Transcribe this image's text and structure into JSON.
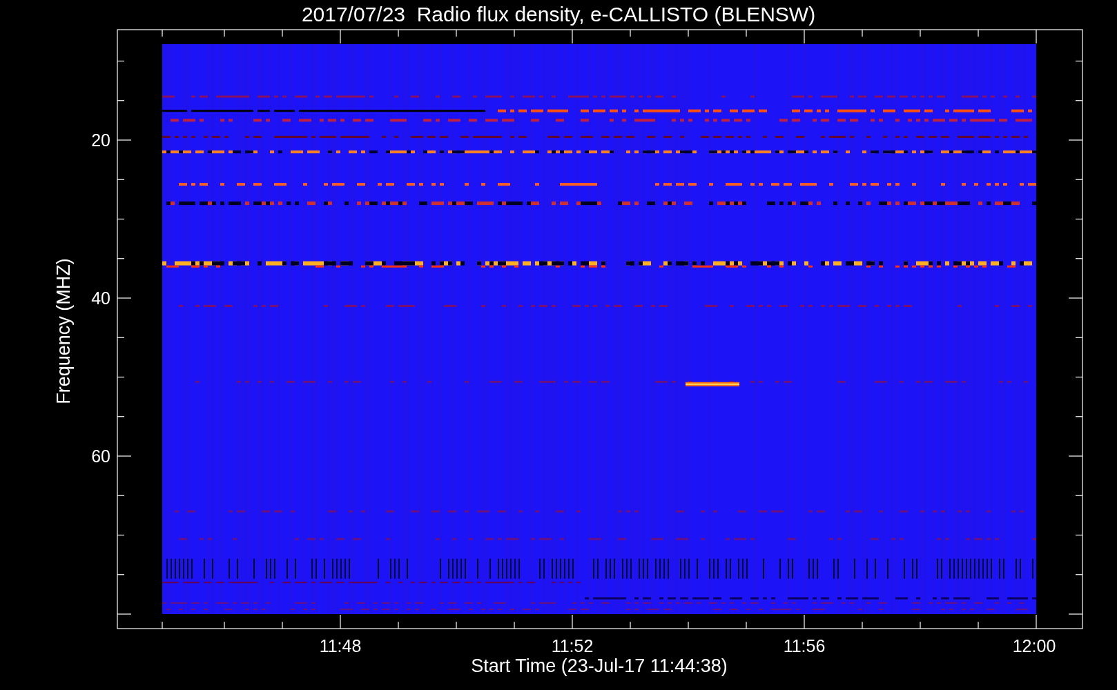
{
  "title": "2017/07/23  Radio flux density, e-CALLISTO (BLENSW)",
  "y_axis": {
    "label": "Frequency (MHZ)",
    "ticks": [
      "20",
      "40",
      "60"
    ]
  },
  "x_axis": {
    "label": "Start Time (23-Jul-17 11:44:38)",
    "ticks": [
      "11:48",
      "11:52",
      "11:56",
      "12:00"
    ]
  }
}
